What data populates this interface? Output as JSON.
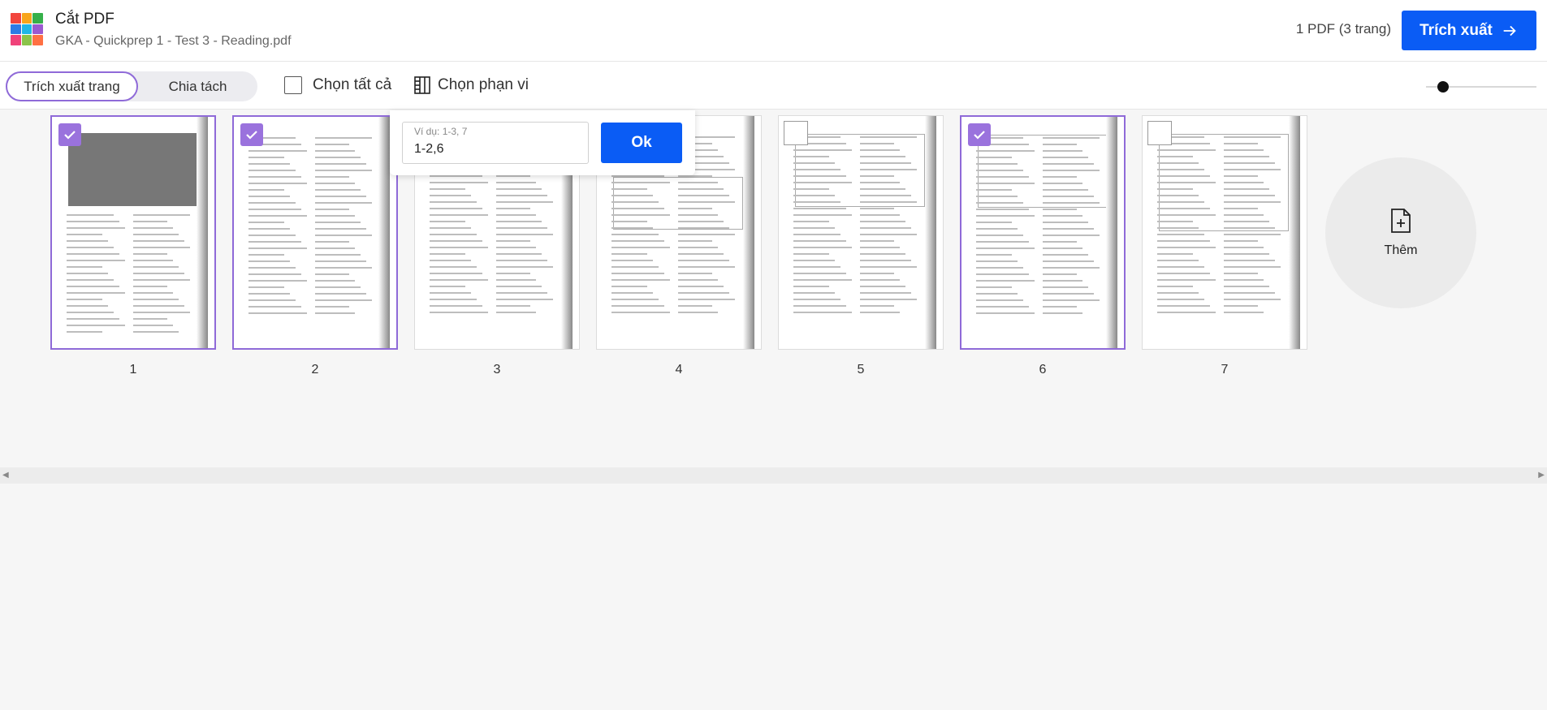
{
  "header": {
    "title": "Cắt PDF",
    "file_name": "GKA - Quickprep 1 - Test 3 - Reading.pdf",
    "pdf_count": "1 PDF (3 trang)",
    "export_label": "Trích xuất",
    "logo_colors": [
      "#f2453d",
      "#f8a51c",
      "#36b04a",
      "#2c7be5",
      "#1fb6e8",
      "#9b59d0",
      "#f0427a",
      "#8bc34a",
      "#ff7043"
    ]
  },
  "toolbar": {
    "tab_extract": "Trích xuất trang",
    "tab_split": "Chia tách",
    "select_all": "Chọn tất cả",
    "select_range": "Chọn phạn vi"
  },
  "range_popup": {
    "hint": "Ví dụ: 1-3, 7",
    "value": "1-2,6",
    "ok_label": "Ok"
  },
  "pages": [
    {
      "number": "1",
      "selected": true
    },
    {
      "number": "2",
      "selected": true
    },
    {
      "number": "3",
      "selected": false
    },
    {
      "number": "4",
      "selected": false
    },
    {
      "number": "5",
      "selected": false
    },
    {
      "number": "6",
      "selected": true
    },
    {
      "number": "7",
      "selected": false
    }
  ],
  "add_label": "Thêm",
  "colors": {
    "accent": "#0a5cf5",
    "selection": "#8f6ad8"
  }
}
